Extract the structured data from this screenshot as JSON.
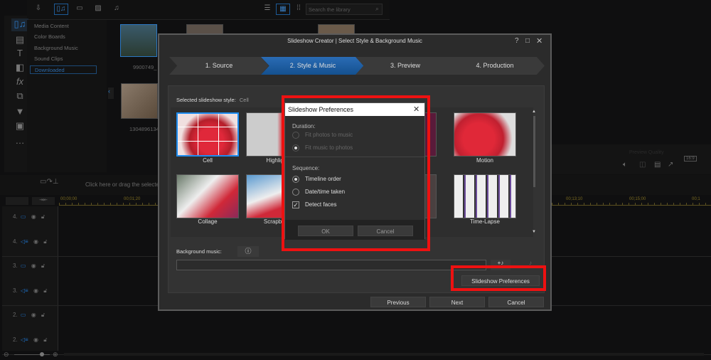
{
  "library": {
    "categories": [
      "Media Content",
      "Color Boards",
      "Background Music",
      "Sound Clips",
      "Downloaded"
    ],
    "selected_category": "Downloaded",
    "search_placeholder": "Search the library",
    "thumbnails": [
      "9900749_",
      "1304896134"
    ]
  },
  "timeline": {
    "hint": "Click here or drag the selected",
    "ruler": [
      "00;00;00",
      "00;01;20",
      "00;13;10",
      "00;15;00",
      "00;1"
    ],
    "tracks": [
      {
        "n": "4.",
        "type": "video"
      },
      {
        "n": "4.",
        "type": "audio"
      },
      {
        "n": "3.",
        "type": "video"
      },
      {
        "n": "3.",
        "type": "audio"
      },
      {
        "n": "2.",
        "type": "video"
      },
      {
        "n": "2.",
        "type": "audio"
      }
    ]
  },
  "preview": {
    "aspect": "16:9",
    "quality_label": "Preview Quality"
  },
  "dialog": {
    "title": "Slideshow Creator | Select Style & Background Music",
    "steps": [
      "1. Source",
      "2. Style & Music",
      "3. Preview",
      "4. Production"
    ],
    "active_step": 1,
    "selected_style_label": "Selected slideshow style:",
    "selected_style": "Cell",
    "styles": [
      "Cell",
      "Highlight",
      "Motion",
      "Collage",
      "Scrapbook",
      "Time-Lapse"
    ],
    "background_music_label": "Background music:",
    "preferences_button": "Slideshow Preferences",
    "buttons": {
      "previous": "Previous",
      "next": "Next",
      "cancel": "Cancel"
    }
  },
  "preferences": {
    "title": "Slideshow Preferences",
    "duration_label": "Duration:",
    "duration_options": [
      "Fit photos to music",
      "Fit music to photos"
    ],
    "sequence_label": "Sequence:",
    "sequence_options": [
      "Timeline order",
      "Date/time taken"
    ],
    "detect_faces": "Detect faces",
    "detect_faces_checked": true,
    "ok": "OK",
    "cancel": "Cancel"
  },
  "colors": {
    "accent": "#1d6fc4",
    "highlight": "#ee1111"
  }
}
